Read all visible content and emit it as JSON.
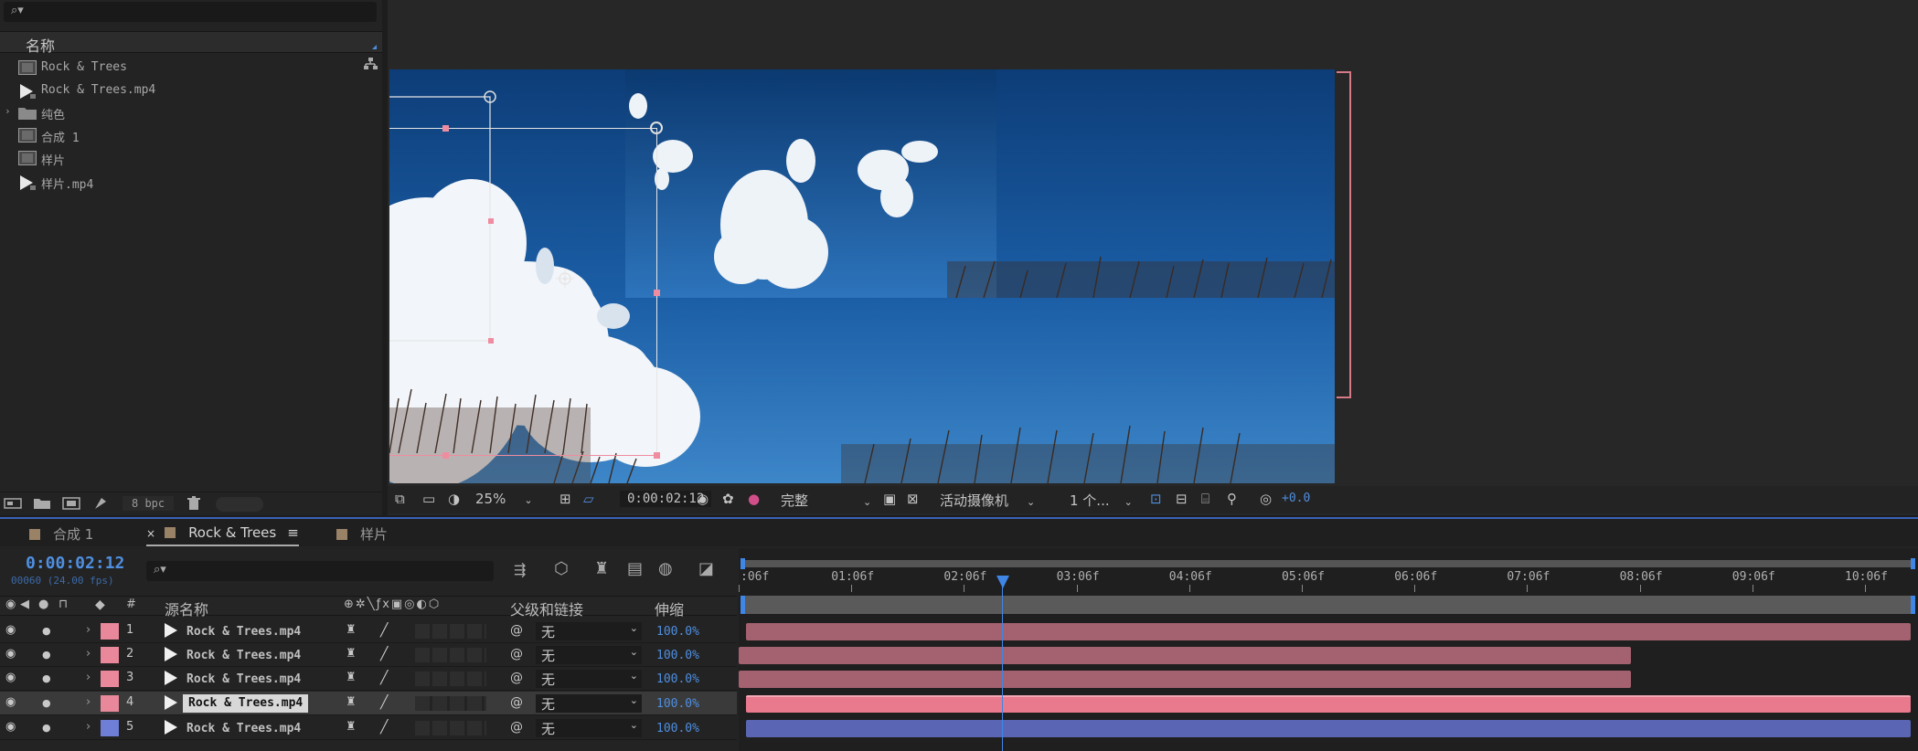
{
  "project_panel": {
    "search_placeholder": "",
    "column_name": "名称",
    "items": [
      {
        "label": "Rock & Trees",
        "type": "composition"
      },
      {
        "label": "Rock & Trees.mp4",
        "type": "footage"
      },
      {
        "label": "纯色",
        "type": "folder"
      },
      {
        "label": "合成 1",
        "type": "composition"
      },
      {
        "label": "样片",
        "type": "composition"
      },
      {
        "label": "样片.mp4",
        "type": "footage"
      }
    ],
    "bit_depth": "8 bpc"
  },
  "viewer": {
    "zoom": "25%",
    "timecode": "0:00:02:12",
    "resolution": "完整",
    "camera": "活动摄像机",
    "views": "1 个...",
    "exposure": "+0.0"
  },
  "timeline": {
    "tabs": [
      {
        "label": "合成 1",
        "active": false
      },
      {
        "label": "Rock & Trees",
        "active": true
      },
      {
        "label": "样片",
        "active": false
      }
    ],
    "current_time": "0:00:02:12",
    "frame_info": "00060 (24.00 fps)",
    "search_placeholder": "",
    "columns": {
      "number": "#",
      "source_name": "源名称",
      "parent": "父级和链接",
      "stretch": "伸缩"
    },
    "ruler": [
      ":06f",
      "01:06f",
      "02:06f",
      "03:06f",
      "04:06f",
      "05:06f",
      "06:06f",
      "07:06f",
      "08:06f",
      "09:06f",
      "10:06f"
    ],
    "layers": [
      {
        "num": "1",
        "name": "Rock & Trees.mp4",
        "parent": "无",
        "stretch": "100.0%",
        "color": "#e8889a",
        "selected": false
      },
      {
        "num": "2",
        "name": "Rock & Trees.mp4",
        "parent": "无",
        "stretch": "100.0%",
        "color": "#e8889a",
        "selected": false
      },
      {
        "num": "3",
        "name": "Rock & Trees.mp4",
        "parent": "无",
        "stretch": "100.0%",
        "color": "#e8889a",
        "selected": false
      },
      {
        "num": "4",
        "name": "Rock & Trees.mp4",
        "parent": "无",
        "stretch": "100.0%",
        "color": "#e8889a",
        "selected": true
      },
      {
        "num": "5",
        "name": "Rock & Trees.mp4",
        "parent": "无",
        "stretch": "100.0%",
        "color": "#6f7fd8",
        "selected": false
      }
    ]
  },
  "colors": {
    "accent": "#4f8fe0",
    "label_red": "#e8889a",
    "label_blue": "#6f7fd8",
    "playhead": "#3f86e6"
  }
}
